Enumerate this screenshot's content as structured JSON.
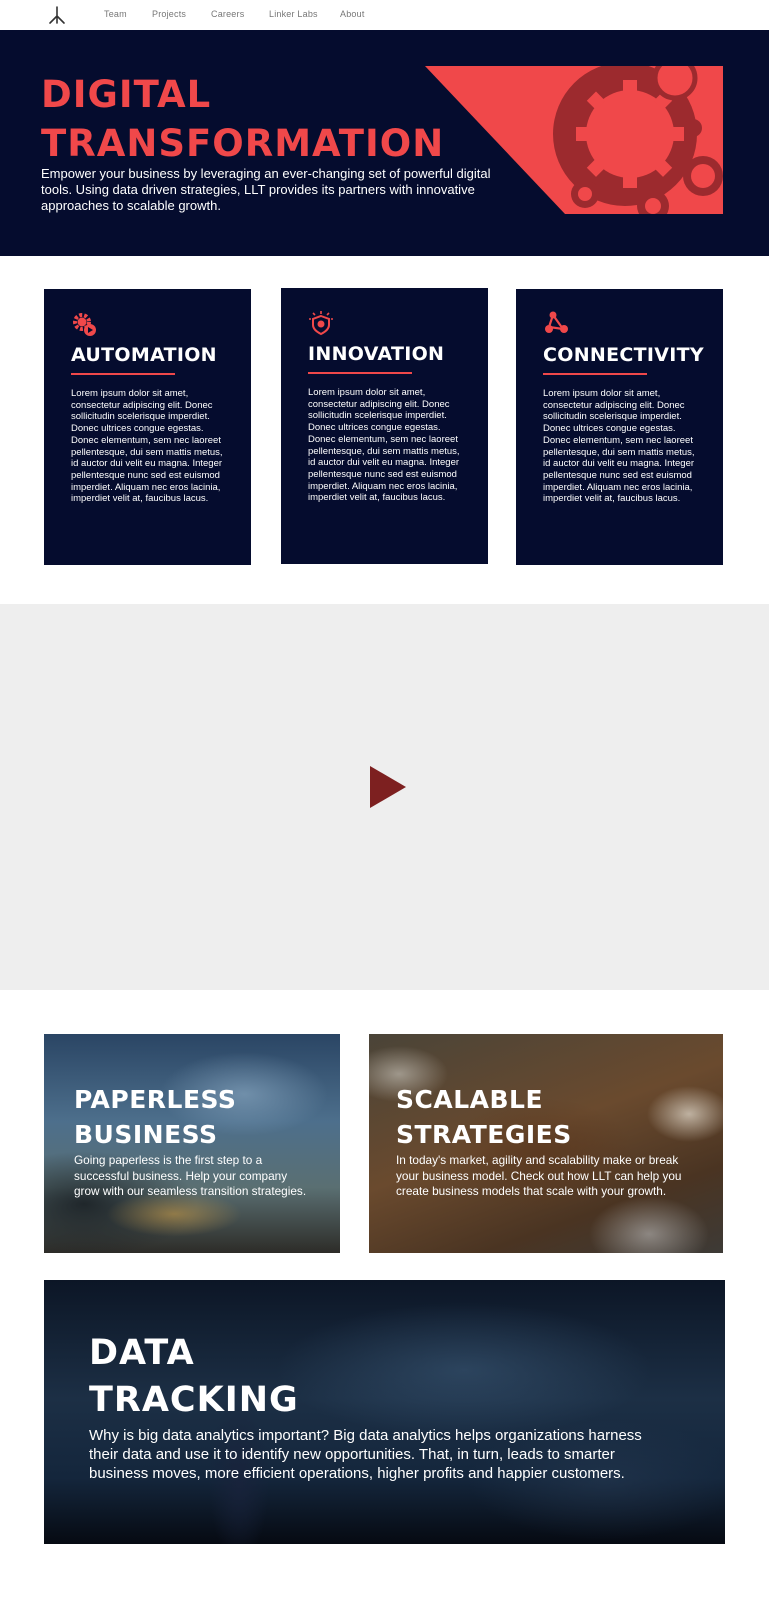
{
  "nav": {
    "links": [
      "Team",
      "Projects",
      "Careers",
      "Linker Labs",
      "About"
    ]
  },
  "hero": {
    "title_line1": "Digital",
    "title_line2": "Transformation",
    "text": "Empower your business by leveraging an ever-changing set of powerful digital tools. Using data driven strategies, LLT provides its partners with innovative approaches to scalable growth."
  },
  "cards": [
    {
      "title": "AUTOMATION",
      "icon": "gear-play-icon",
      "text": "Lorem ipsum dolor sit amet, consectetur adipiscing elit. Donec sollicitudin scelerisque imperdiet. Donec ultrices congue egestas. Donec elementum, sem nec laoreet pellentesque, dui sem mattis metus, id auctor dui velit eu magna. Integer pellentesque nunc sed est euismod imperdiet. Aliquam nec eros lacinia, imperdiet velit at, faucibus lacus."
    },
    {
      "title": "INNOVATION",
      "icon": "lightbulb-shield-icon",
      "text": "Lorem ipsum dolor sit amet, consectetur adipiscing elit. Donec sollicitudin scelerisque imperdiet. Donec ultrices congue egestas. Donec elementum, sem nec laoreet pellentesque, dui sem mattis metus, id auctor dui velit eu magna. Integer pellentesque nunc sed est euismod imperdiet. Aliquam nec eros lacinia, imperdiet velit at, faucibus lacus."
    },
    {
      "title": "CONNECTIVITY",
      "icon": "network-nodes-icon",
      "text": "Lorem ipsum dolor sit amet, consectetur adipiscing elit. Donec sollicitudin scelerisque imperdiet. Donec ultrices congue egestas. Donec elementum, sem nec laoreet pellentesque, dui sem mattis metus, id auctor dui velit eu magna. Integer pellentesque nunc sed est euismod imperdiet. Aliquam nec eros lacinia, imperdiet velit at, faucibus lacus."
    }
  ],
  "promos": [
    {
      "title_line1": "Paperless",
      "title_line2": "Business",
      "text": "Going paperless is the first step to a successful business. Help your company grow with our seamless transition strategies."
    },
    {
      "title_line1": "Scalable",
      "title_line2": "Strategies",
      "text": "In today's market, agility and scalability make or break your business model. Check out how LLT can help you create business models that scale with your growth."
    },
    {
      "title_line1": "Data",
      "title_line2": "Tracking",
      "text": "Why is big data analytics important? Big data analytics helps organizations harness their data and use it to identify new opportunities. That, in turn, leads to smarter business moves, more efficient operations, higher profits and happier customers."
    }
  ],
  "colors": {
    "navy": "#050c2e",
    "accent_red": "#f0484a",
    "play_button": "#7d2020",
    "video_bg": "#eeeeee"
  }
}
